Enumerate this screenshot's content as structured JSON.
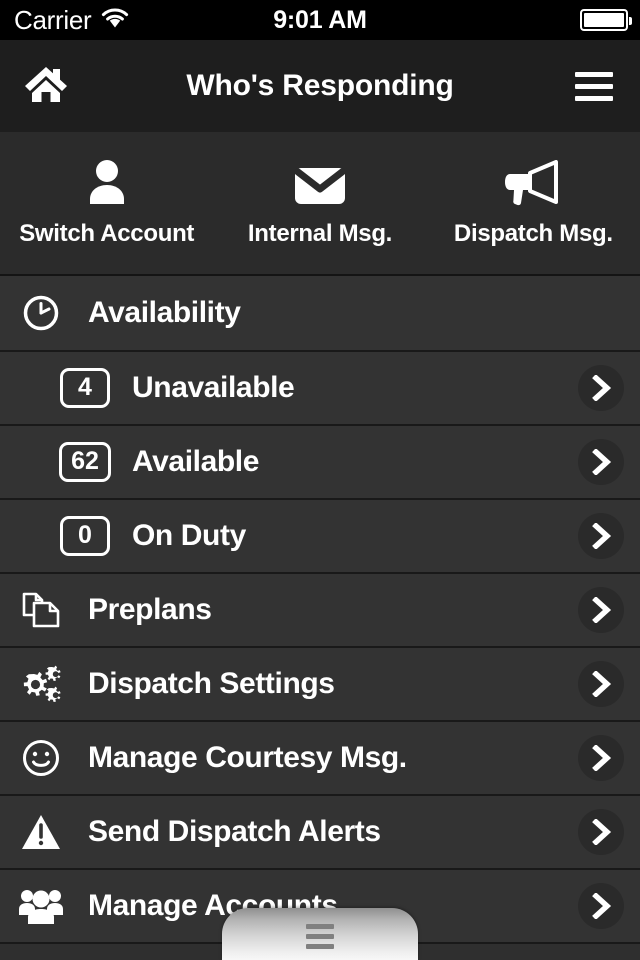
{
  "status_bar": {
    "carrier": "Carrier",
    "wifi_icon": "wifi-icon",
    "time": "9:01 AM",
    "battery_icon": "battery-full-icon"
  },
  "nav_bar": {
    "home_icon": "home-icon",
    "title": "Who's Responding",
    "menu_icon": "hamburger-menu-icon"
  },
  "quick_actions": [
    {
      "id": "switch-account",
      "label": "Switch Account",
      "icon": "person-icon"
    },
    {
      "id": "internal-msg",
      "label": "Internal Msg.",
      "icon": "envelope-icon"
    },
    {
      "id": "dispatch-msg",
      "label": "Dispatch Msg.",
      "icon": "megaphone-icon"
    }
  ],
  "availability": {
    "header_label": "Availability",
    "header_icon": "clock-icon",
    "items": [
      {
        "count": "4",
        "label": "Unavailable",
        "chevron": "chevron-right-icon"
      },
      {
        "count": "62",
        "label": "Available",
        "chevron": "chevron-right-icon"
      },
      {
        "count": "0",
        "label": "On Duty",
        "chevron": "chevron-right-icon"
      }
    ]
  },
  "menu": [
    {
      "label": "Preplans",
      "icon": "documents-icon",
      "chevron": "chevron-right-icon"
    },
    {
      "label": "Dispatch Settings",
      "icon": "gears-icon",
      "chevron": "chevron-right-icon"
    },
    {
      "label": "Manage Courtesy Msg.",
      "icon": "smiley-icon",
      "chevron": "chevron-right-icon"
    },
    {
      "label": "Send Dispatch Alerts",
      "icon": "warning-triangle-icon",
      "chevron": "chevron-right-icon"
    },
    {
      "label": "Manage Accounts",
      "icon": "people-group-icon",
      "chevron": "chevron-right-icon"
    }
  ],
  "overlay": {
    "handle_icon": "hamburger-handle-icon"
  },
  "colors": {
    "status_bar_bg": "#000000",
    "nav_bar_bg": "#1e1e1e",
    "actions_bg": "#2b2b2b",
    "row_bg": "#333333",
    "separator": "#191919",
    "text": "#ffffff"
  }
}
